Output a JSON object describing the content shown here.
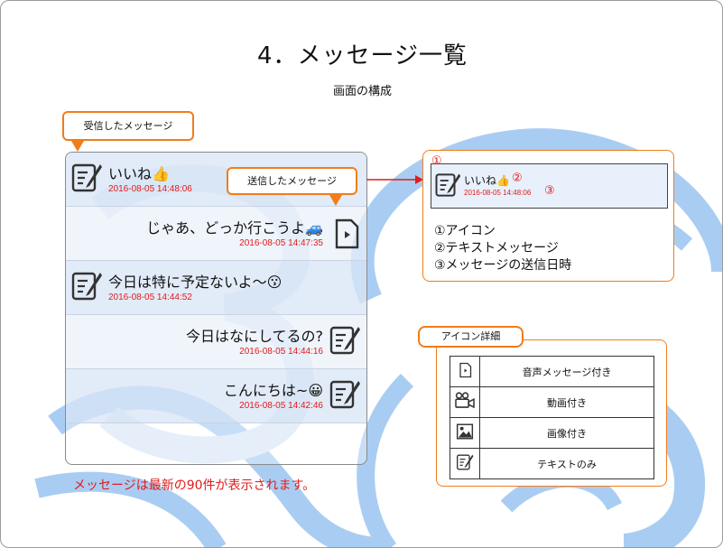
{
  "title": "4．メッセージ一覧",
  "subtitle": "画面の構成",
  "callouts": {
    "received": "受信したメッセージ",
    "sent": "送信したメッセージ",
    "icon_detail": "アイコン詳細"
  },
  "messages": [
    {
      "side": "left",
      "icon": "text-icon",
      "text": "いいね👍",
      "time": "2016-08-05 14:48:06"
    },
    {
      "side": "right",
      "icon": "audio-file-icon",
      "text": "じゃあ、どっか行こうよ🚙",
      "time": "2016-08-05 14:47:35"
    },
    {
      "side": "left",
      "icon": "text-icon",
      "text": "今日は特に予定ないよ〜😗",
      "time": "2016-08-05 14:44:52"
    },
    {
      "side": "right",
      "icon": "text-icon",
      "text": "今日はなにしてるの?",
      "time": "2016-08-05 14:44:16"
    },
    {
      "side": "right",
      "icon": "text-icon",
      "text": "こんにちは~😀",
      "time": "2016-08-05 14:42:46"
    }
  ],
  "note": "メッセージは最新の90件が表示されます。",
  "sample": {
    "text": "いいね👍",
    "time": "2016-08-05 14:48:06",
    "marker1": "①",
    "marker2": "②",
    "marker3": "③"
  },
  "legend": [
    "①アイコン",
    "②テキストメッセージ",
    "③メッセージの送信日時"
  ],
  "icon_table": [
    {
      "icon": "audio-file-icon",
      "label": "音声メッセージ付き"
    },
    {
      "icon": "video-camera-icon",
      "label": "動画付き"
    },
    {
      "icon": "image-icon",
      "label": "画像付き"
    },
    {
      "icon": "text-icon",
      "label": "テキストのみ"
    }
  ],
  "colors": {
    "accent_orange": "#f07d1a",
    "timestamp_red": "#e21b1b",
    "watermark_blue": "#a9cdf2"
  }
}
